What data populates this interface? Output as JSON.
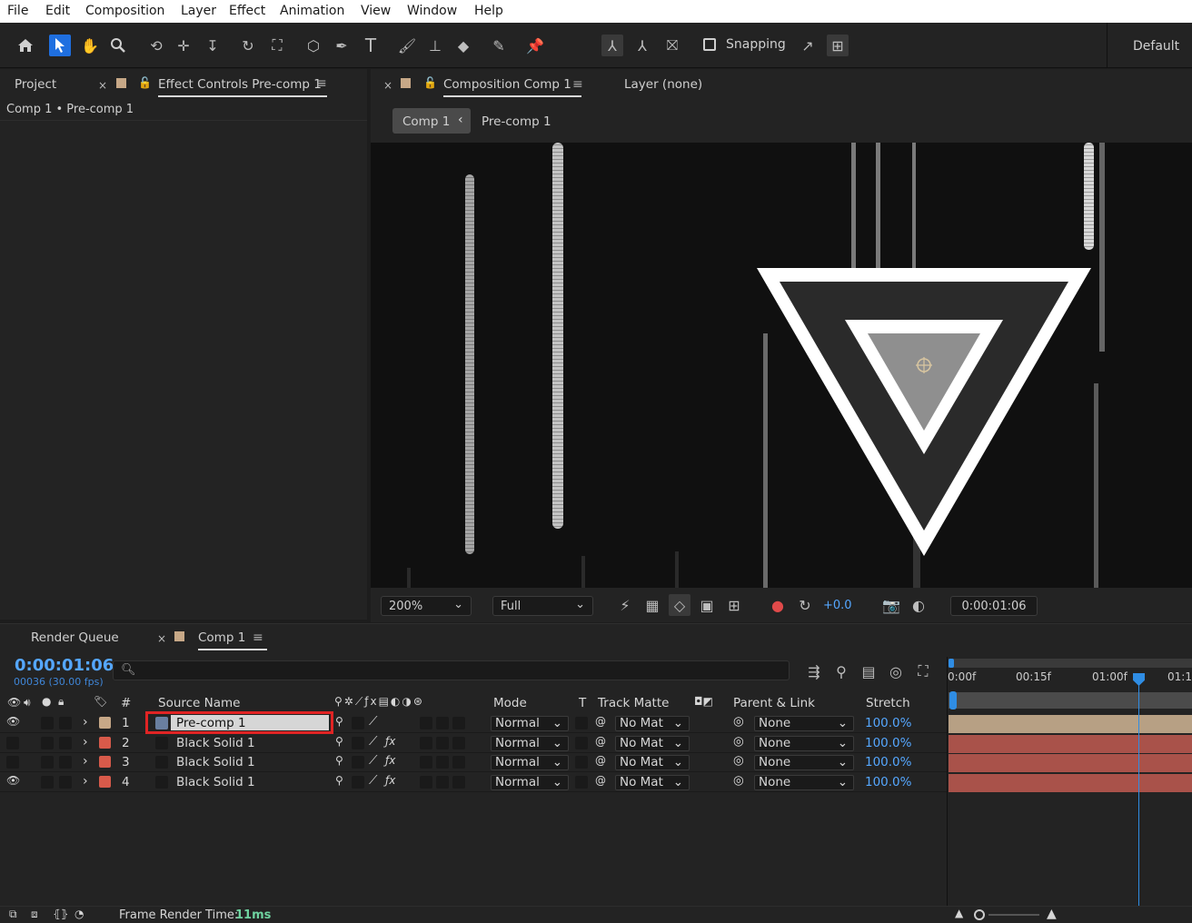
{
  "menu": [
    "File",
    "Edit",
    "Composition",
    "Layer",
    "Effect",
    "Animation",
    "View",
    "Window",
    "Help"
  ],
  "toolbar": {
    "snapping_label": "Snapping",
    "workspace_label": "Default"
  },
  "project_panel": {
    "tab_project": "Project",
    "tab_effect_controls": "Effect Controls Pre-comp 1",
    "breadcrumb": "Comp 1 • Pre-comp 1"
  },
  "comp_panel": {
    "tab_composition": "Composition Comp 1",
    "tab_layer": "Layer (none)",
    "crumb_comp": "Comp 1",
    "crumb_precomp": "Pre-comp 1",
    "zoom": "200%",
    "resolution": "Full",
    "exposure": "+0.0",
    "timecode": "0:00:01:06"
  },
  "timeline": {
    "tab_render_queue": "Render Queue",
    "tab_comp": "Comp 1",
    "current_time": "0:00:01:06",
    "frame_info": "00036 (30.00 fps)",
    "search_placeholder": "",
    "columns": {
      "num": "#",
      "source": "Source Name",
      "mode": "Mode",
      "t": "T",
      "track_matte": "Track Matte",
      "parent": "Parent & Link",
      "stretch": "Stretch"
    },
    "ruler": [
      "0:00f",
      "00:15f",
      "01:00f",
      "01:1"
    ],
    "layers": [
      {
        "num": "1",
        "name": "Pre-comp 1",
        "mode": "Normal",
        "matte": "No Mat",
        "parent": "None",
        "stretch": "100.0%",
        "color": "#c7a887",
        "visible": true
      },
      {
        "num": "2",
        "name": "Black Solid 1",
        "mode": "Normal",
        "matte": "No Mat",
        "parent": "None",
        "stretch": "100.0%",
        "color": "#d85a4a",
        "visible": false
      },
      {
        "num": "3",
        "name": "Black Solid 1",
        "mode": "Normal",
        "matte": "No Mat",
        "parent": "None",
        "stretch": "100.0%",
        "color": "#d85a4a",
        "visible": false
      },
      {
        "num": "4",
        "name": "Black Solid 1",
        "mode": "Normal",
        "matte": "No Mat",
        "parent": "None",
        "stretch": "100.0%",
        "color": "#d85a4a",
        "visible": true
      }
    ],
    "frame_render_label": "Frame Render Time:",
    "frame_render_value": "11ms"
  },
  "colors": {
    "accent": "#1f6fe0",
    "highlight": "#e02424",
    "precomp_bar": "#b7a084",
    "solid_bar": "#a9524a"
  }
}
